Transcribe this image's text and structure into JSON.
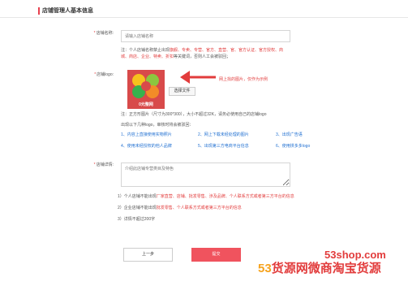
{
  "header": {
    "title": "店铺管理人基本信息"
  },
  "shop_name": {
    "label": "店铺名称:",
    "placeholder": "请输入店铺名称",
    "note_prefix": "注：个人店铺名称禁止出现",
    "note_red": "旗舰、专卖、专营、官方、直营、官、官方认证、官方授权、商城、商店、企业、特卖、折扣",
    "note_suffix": "等关键词，否则人工会被驳回；"
  },
  "shop_logo": {
    "label": "店铺logo:",
    "logo_text": "0元整网",
    "upload_button": "选择文件",
    "arrow_note": "网上找的图片，仅作为示例",
    "size_note": "注：正方形图片（尺寸为300*300），大小不超过32K，请务必使用自己的店铺logo",
    "reject_intro": "出现以下几种logo，审核时将会被驳回：",
    "rules": [
      "1、内容上直接使用实物照片",
      "2、网上下载未经处理的图片",
      "3、出现广告语",
      "4、使用未经授权的他人品牌",
      "5、出现第三方电商平台信息",
      "6、使用拼多多logo"
    ]
  },
  "shop_desc": {
    "label": "店铺详情:",
    "placeholder": "介绍此店铺专营类目及特色",
    "tips": [
      {
        "prefix": "1）个人店铺不能出现",
        "red": "厂家直营、店铺、批发零售、涉及品牌、个人联系方式或者第三方平台的信息",
        "suffix": ""
      },
      {
        "prefix": "2）企业店铺不能出现",
        "red": "批发零售、个人联系方式或者第三方平台的信息",
        "suffix": ""
      },
      {
        "prefix": "3）详情不超过200字",
        "red": "",
        "suffix": ""
      }
    ]
  },
  "buttons": {
    "prev": "上一步",
    "submit": "提交"
  },
  "watermark": {
    "site": "53shop.com",
    "brand_a": "53",
    "brand_b": "货源网",
    "brand_c": "微商淘宝货源"
  },
  "colors": {
    "accent": "#f0535e",
    "red_text": "#e23c3c",
    "link_blue": "#1f6fd1"
  }
}
